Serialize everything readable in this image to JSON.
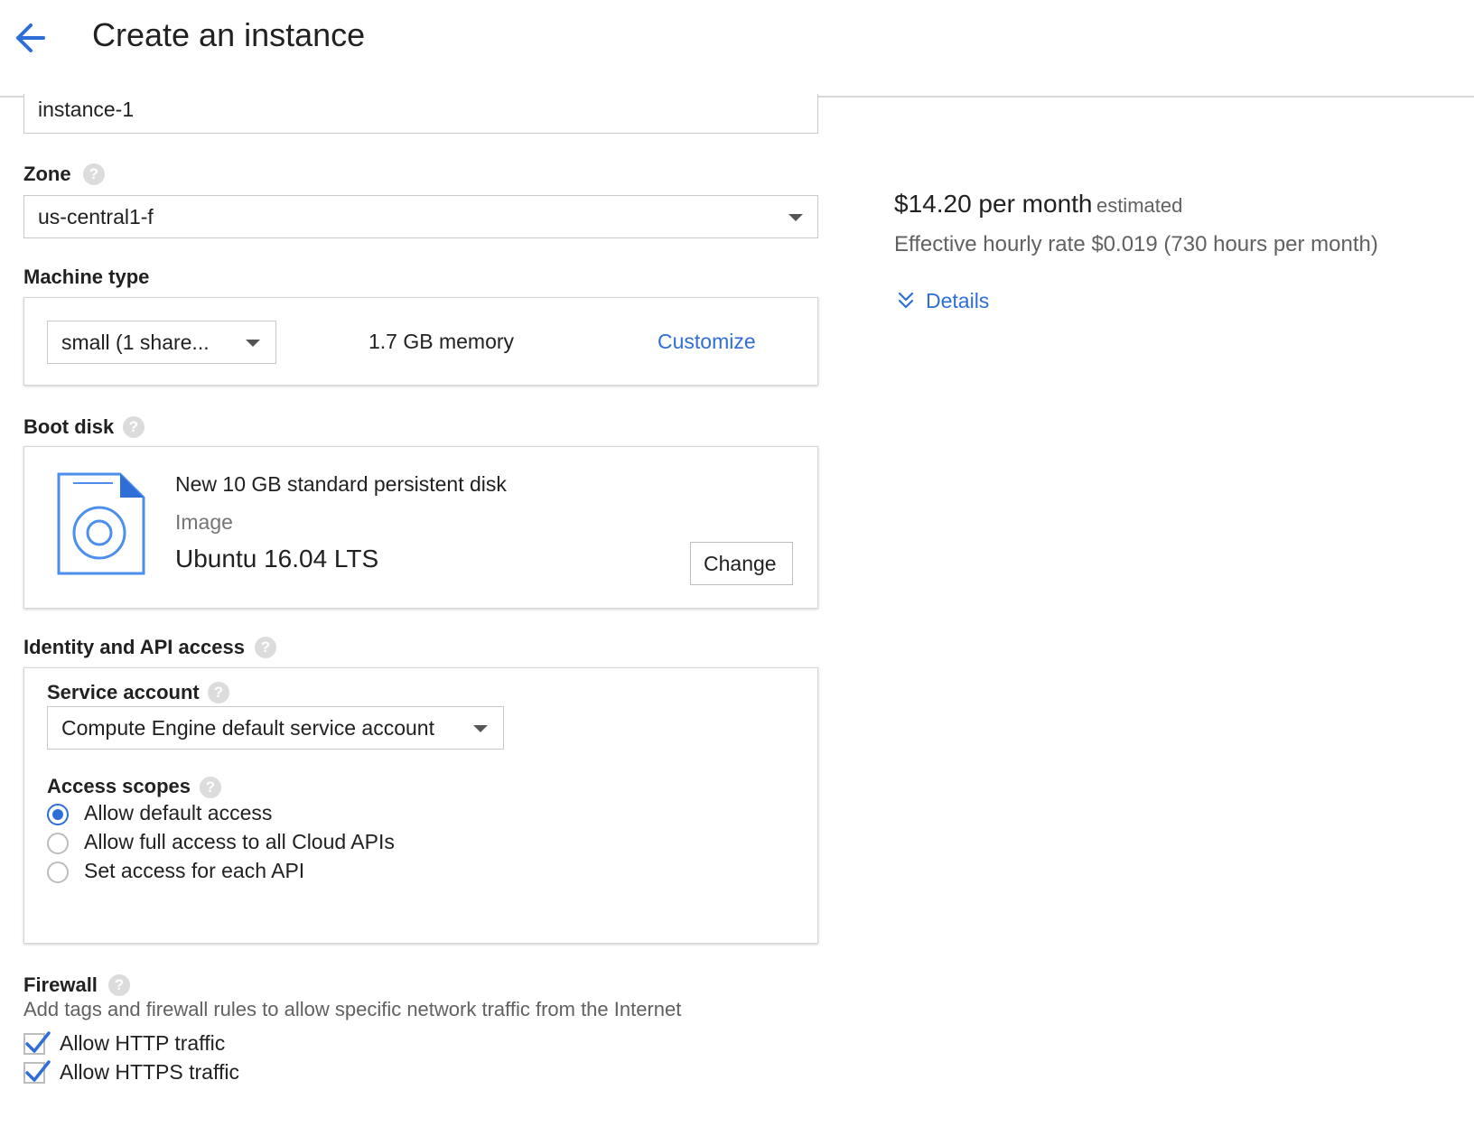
{
  "header": {
    "title": "Create an instance",
    "back_icon": "arrow-back-icon"
  },
  "name_field": {
    "value": "instance-1"
  },
  "zone": {
    "label": "Zone",
    "value": "us-central1-f"
  },
  "machine_type": {
    "label": "Machine type",
    "selected": "small (1 share...",
    "memory": "1.7 GB memory",
    "customize_label": "Customize"
  },
  "boot_disk": {
    "label": "Boot disk",
    "disk_title": "New 10 GB standard persistent disk",
    "image_label": "Image",
    "image_value": "Ubuntu 16.04 LTS",
    "change_label": "Change",
    "icon": "disk-file-icon"
  },
  "identity": {
    "label": "Identity and API access",
    "service_account": {
      "label": "Service account",
      "value": "Compute Engine default service account"
    },
    "access_scopes": {
      "label": "Access scopes",
      "options": [
        {
          "label": "Allow default access",
          "checked": true
        },
        {
          "label": "Allow full access to all Cloud APIs",
          "checked": false
        },
        {
          "label": "Set access for each API",
          "checked": false
        }
      ]
    }
  },
  "firewall": {
    "label": "Firewall",
    "description": "Add tags and firewall rules to allow specific network traffic from the Internet",
    "options": [
      {
        "label": "Allow HTTP traffic",
        "checked": true
      },
      {
        "label": "Allow HTTPS traffic",
        "checked": true
      }
    ]
  },
  "pricing": {
    "price": "$14.20 per month",
    "estimated": "estimated",
    "hourly": "Effective hourly rate $0.019 (730 hours per month)",
    "details_label": "Details"
  },
  "colors": {
    "accent": "#2e6ed6",
    "border": "#c9c9c9",
    "help": "#dcdcdc"
  }
}
